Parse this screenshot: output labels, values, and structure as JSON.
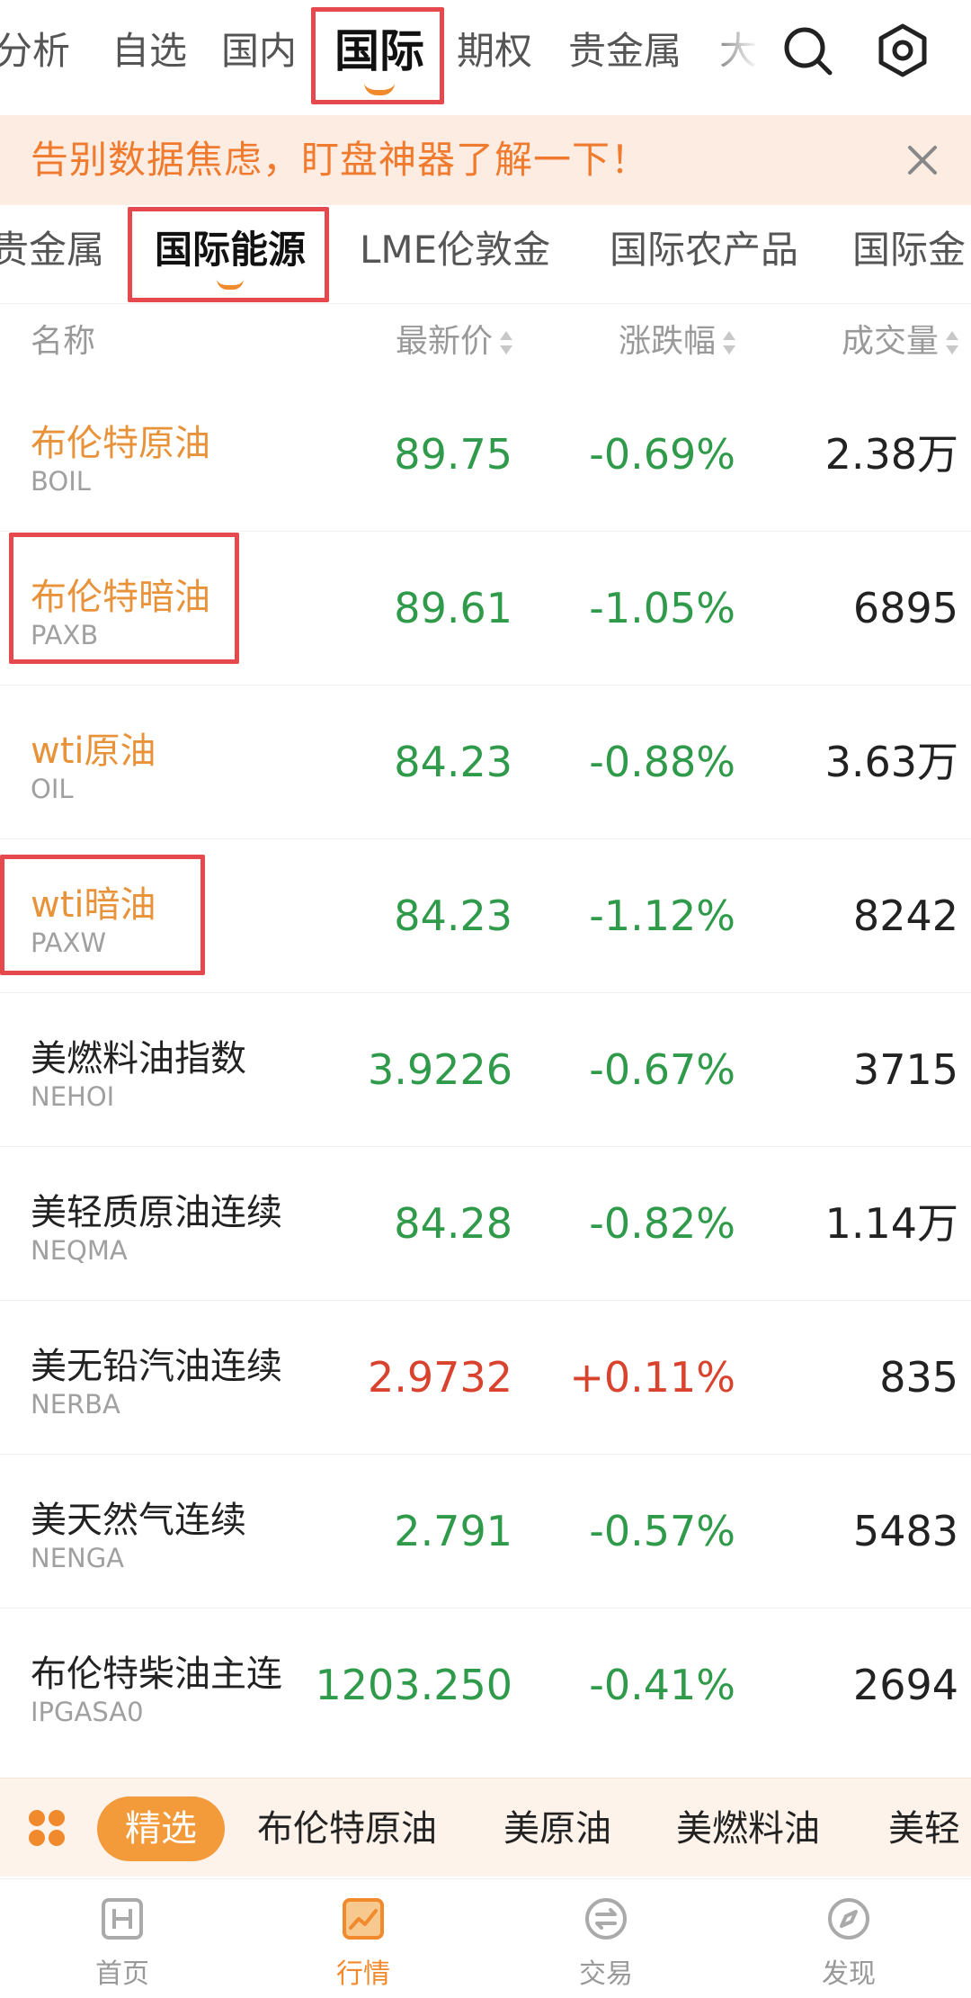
{
  "top_tabs": [
    {
      "label": "分析"
    },
    {
      "label": "自选"
    },
    {
      "label": "国内"
    },
    {
      "label": "国际",
      "active": true
    },
    {
      "label": "期权"
    },
    {
      "label": "贵金属"
    },
    {
      "label": "大"
    }
  ],
  "banner": {
    "text": "告别数据焦虑，盯盘神器了解一下！"
  },
  "sub_tabs": [
    {
      "label": "贵金属"
    },
    {
      "label": "国际能源",
      "active": true
    },
    {
      "label": "LME伦敦金"
    },
    {
      "label": "国际农产品"
    },
    {
      "label": "国际金"
    }
  ],
  "table_header": {
    "name": "名称",
    "price": "最新价",
    "change": "涨跌幅",
    "volume": "成交量"
  },
  "rows": [
    {
      "name": "布伦特原油",
      "code": "BOIL",
      "price": "89.75",
      "change": "-0.69%",
      "volume": "2.38万",
      "direction": "down",
      "highlight": true
    },
    {
      "name": "布伦特暗油",
      "code": "PAXB",
      "price": "89.61",
      "change": "-1.05%",
      "volume": "6895",
      "direction": "down",
      "highlight": true
    },
    {
      "name": "wti原油",
      "code": "OIL",
      "price": "84.23",
      "change": "-0.88%",
      "volume": "3.63万",
      "direction": "down",
      "highlight": true
    },
    {
      "name": "wti暗油",
      "code": "PAXW",
      "price": "84.23",
      "change": "-1.12%",
      "volume": "8242",
      "direction": "down",
      "highlight": true
    },
    {
      "name": "美燃料油指数",
      "code": "NEHOI",
      "price": "3.9226",
      "change": "-0.67%",
      "volume": "3715",
      "direction": "down",
      "highlight": false
    },
    {
      "name": "美轻质原油连续",
      "code": "NEQMA",
      "price": "84.28",
      "change": "-0.82%",
      "volume": "1.14万",
      "direction": "down",
      "highlight": false
    },
    {
      "name": "美无铅汽油连续",
      "code": "NERBA",
      "price": "2.9732",
      "change": "+0.11%",
      "volume": "835",
      "direction": "up",
      "highlight": false
    },
    {
      "name": "美天然气连续",
      "code": "NENGA",
      "price": "2.791",
      "change": "-0.57%",
      "volume": "5483",
      "direction": "down",
      "highlight": false
    },
    {
      "name": "布伦特柴油主连",
      "code": "IPGASA0",
      "price": "1203.250",
      "change": "-0.41%",
      "volume": "2694",
      "direction": "down",
      "highlight": false
    }
  ],
  "quick_bar": {
    "pill": "精选",
    "items": [
      "布伦特原油",
      "美原油",
      "美燃料油",
      "美轻"
    ]
  },
  "bottom_nav": [
    {
      "label": "首页",
      "icon": "home-h-icon"
    },
    {
      "label": "行情",
      "icon": "market-chart-icon",
      "active": true
    },
    {
      "label": "交易",
      "icon": "trade-exchange-icon"
    },
    {
      "label": "发现",
      "icon": "discover-compass-icon"
    }
  ],
  "colors": {
    "accent": "#f08a2c",
    "down": "#2f9a4a",
    "up": "#d9432e",
    "highlight_name": "#e8923a",
    "annotation_box": "#e5484d"
  }
}
